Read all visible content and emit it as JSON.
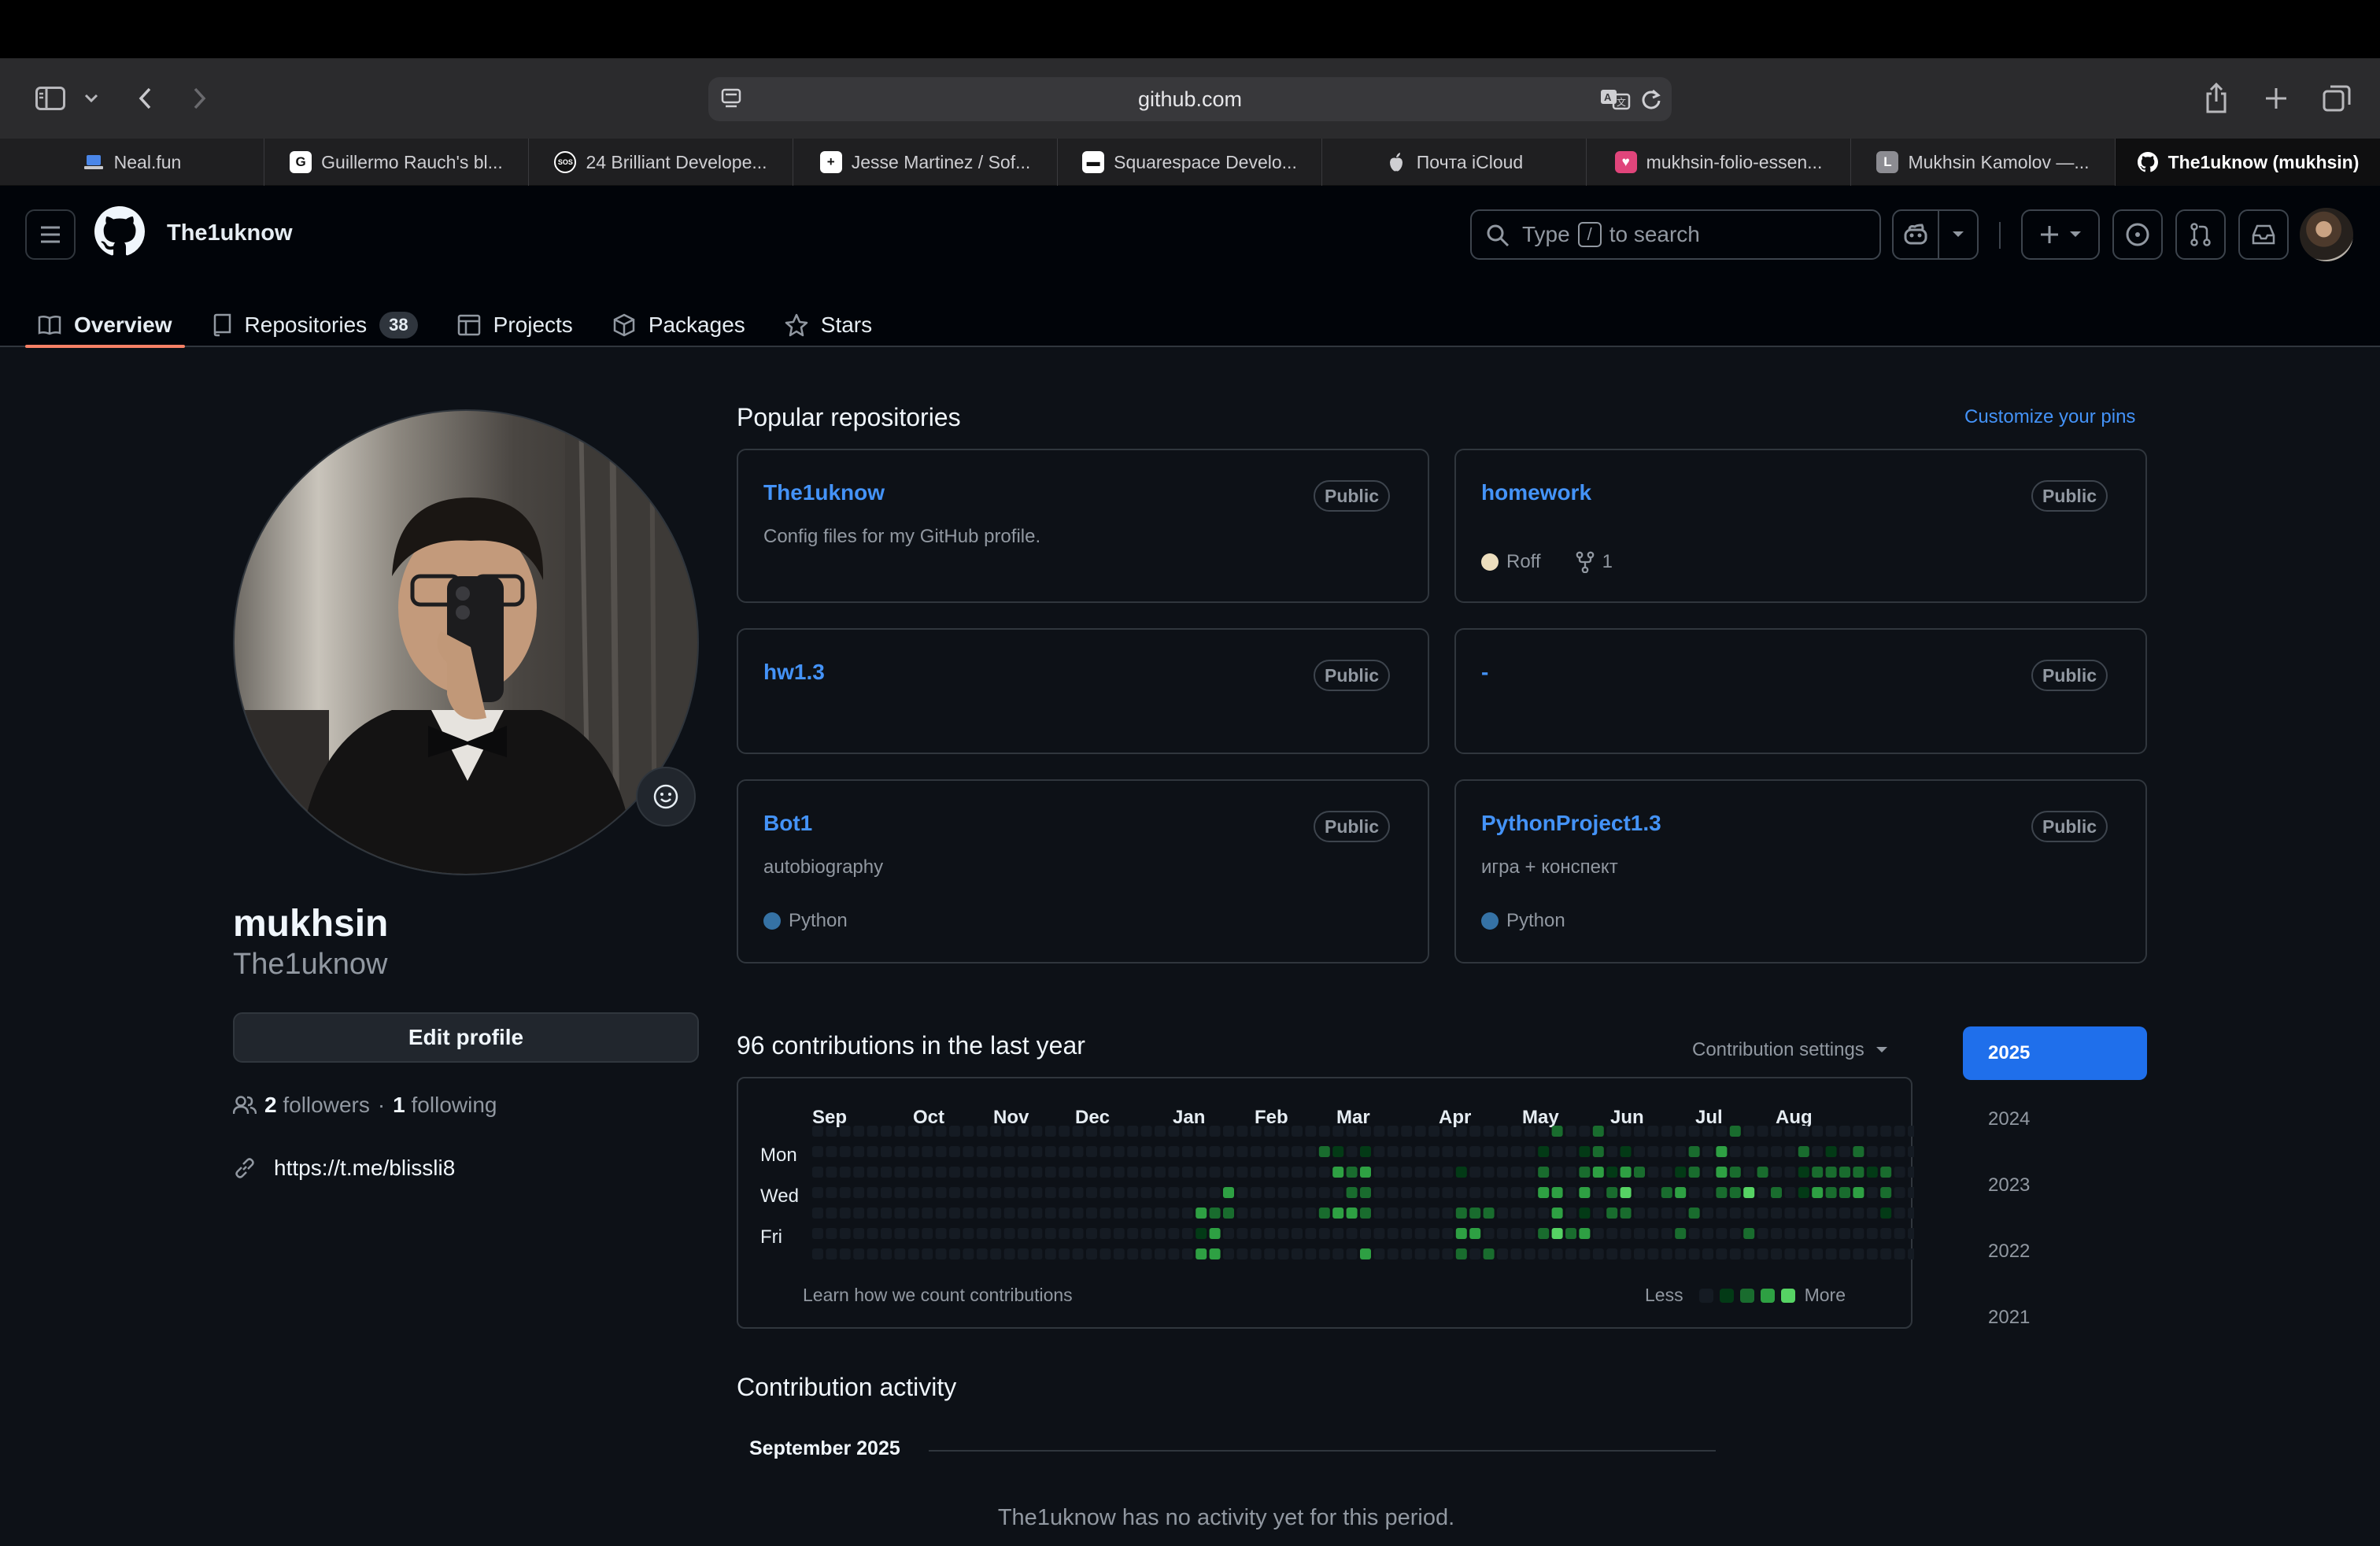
{
  "browser": {
    "url": "github.com",
    "tabs": [
      {
        "label": "Neal.fun",
        "fav": "laptop",
        "favbg": "#3b6fd8",
        "active": false
      },
      {
        "label": "Guillermo Rauch's bl...",
        "fav": "G",
        "favbg": "#ffffff",
        "active": false
      },
      {
        "label": "24 Brilliant Develope...",
        "fav": "SOS",
        "favbg": "#ffffff",
        "active": false
      },
      {
        "label": "Jesse Martinez / Sof...",
        "fav": "+",
        "favbg": "#ffffff",
        "active": false
      },
      {
        "label": "Squarespace Develo...",
        "fav": "▬",
        "favbg": "#ffffff",
        "active": false
      },
      {
        "label": "Почта iCloud",
        "fav": "",
        "favbg": "transparent",
        "active": false
      },
      {
        "label": "mukhsin-folio-essen...",
        "fav": "♥",
        "favbg": "#e0457b",
        "active": false
      },
      {
        "label": "Mukhsin Kamolov —...",
        "fav": "L",
        "favbg": "#8c8c92",
        "active": false
      },
      {
        "label": "The1uknow (mukhsin)",
        "fav": "gh",
        "favbg": "transparent",
        "active": true
      }
    ]
  },
  "header": {
    "username": "The1uknow",
    "search_prefix": "Type",
    "search_key": "/",
    "search_suffix": "to search",
    "nav": [
      {
        "label": "Overview",
        "icon": "book-icon",
        "active": true
      },
      {
        "label": "Repositories",
        "icon": "repo-icon",
        "count": "38",
        "active": false
      },
      {
        "label": "Projects",
        "icon": "table-icon",
        "active": false
      },
      {
        "label": "Packages",
        "icon": "package-icon",
        "active": false
      },
      {
        "label": "Stars",
        "icon": "star-icon",
        "active": false
      }
    ]
  },
  "profile": {
    "name": "mukhsin",
    "login": "The1uknow",
    "edit_label": "Edit profile",
    "followers_count": "2",
    "followers_label": "followers",
    "separator": "·",
    "following_count": "1",
    "following_label": "following",
    "link": "https://t.me/blissli8"
  },
  "pinned": {
    "title": "Popular repositories",
    "customize_label": "Customize your pins",
    "repos": [
      {
        "name": "The1uknow",
        "visibility": "Public",
        "description": "Config files for my GitHub profile.",
        "language": "",
        "lang_color": "",
        "forks": ""
      },
      {
        "name": "homework",
        "visibility": "Public",
        "description": "",
        "language": "Roff",
        "lang_color": "#ecdebe",
        "forks": "1"
      },
      {
        "name": "hw1.3",
        "visibility": "Public",
        "description": "",
        "language": "",
        "lang_color": "",
        "forks": ""
      },
      {
        "name": "-",
        "visibility": "Public",
        "description": "",
        "language": "",
        "lang_color": "",
        "forks": ""
      },
      {
        "name": "Bot1",
        "visibility": "Public",
        "description": "autobiography",
        "language": "Python",
        "lang_color": "#3572A5",
        "forks": ""
      },
      {
        "name": "PythonProject1.3",
        "visibility": "Public",
        "description": "игра + конспект",
        "language": "Python",
        "lang_color": "#3572A5",
        "forks": ""
      }
    ]
  },
  "contributions": {
    "title": "96 contributions in the last year",
    "settings_label": "Contribution settings",
    "months": [
      "Sep",
      "Oct",
      "Nov",
      "Dec",
      "Jan",
      "Feb",
      "Mar",
      "Apr",
      "May",
      "Jun",
      "Jul",
      "Aug"
    ],
    "days": [
      "Mon",
      "Wed",
      "Fri"
    ],
    "learn_label": "Learn how we count contributions",
    "less_label": "Less",
    "more_label": "More",
    "colors": [
      "#151b23",
      "#033a16",
      "#196c2e",
      "#2ea043",
      "#56d364"
    ],
    "weeks": 53,
    "active_cells": [
      [
        28,
        4,
        3
      ],
      [
        28,
        5,
        1
      ],
      [
        28,
        6,
        3
      ],
      [
        29,
        4,
        2
      ],
      [
        29,
        5,
        3
      ],
      [
        29,
        6,
        3
      ],
      [
        30,
        3,
        3
      ],
      [
        30,
        4,
        2
      ],
      [
        37,
        1,
        2
      ],
      [
        37,
        4,
        2
      ],
      [
        38,
        1,
        1
      ],
      [
        38,
        2,
        3
      ],
      [
        38,
        4,
        3
      ],
      [
        39,
        2,
        2
      ],
      [
        39,
        3,
        2
      ],
      [
        39,
        4,
        3
      ],
      [
        40,
        1,
        1
      ],
      [
        40,
        2,
        3
      ],
      [
        40,
        3,
        2
      ],
      [
        40,
        4,
        2
      ],
      [
        40,
        6,
        3
      ],
      [
        47,
        2,
        1
      ],
      [
        47,
        4,
        2
      ],
      [
        47,
        5,
        3
      ],
      [
        47,
        6,
        2
      ],
      [
        48,
        4,
        2
      ],
      [
        48,
        5,
        3
      ],
      [
        49,
        4,
        2
      ],
      [
        49,
        6,
        2
      ],
      [
        53,
        1,
        1
      ],
      [
        53,
        2,
        2
      ],
      [
        53,
        3,
        3
      ],
      [
        53,
        5,
        2
      ],
      [
        54,
        0,
        2
      ],
      [
        54,
        3,
        3
      ],
      [
        54,
        4,
        3
      ],
      [
        54,
        5,
        4
      ],
      [
        55,
        5,
        2
      ],
      [
        56,
        1,
        1
      ],
      [
        56,
        2,
        2
      ],
      [
        56,
        3,
        3
      ],
      [
        56,
        4,
        1
      ],
      [
        56,
        5,
        3
      ],
      [
        57,
        0,
        2
      ],
      [
        57,
        1,
        2
      ],
      [
        57,
        2,
        3
      ],
      [
        58,
        2,
        1
      ],
      [
        58,
        3,
        2
      ],
      [
        58,
        4,
        2
      ],
      [
        59,
        1,
        1
      ],
      [
        59,
        2,
        3
      ],
      [
        59,
        3,
        4
      ],
      [
        59,
        4,
        2
      ],
      [
        60,
        2,
        2
      ],
      [
        62,
        3,
        2
      ],
      [
        63,
        2,
        1
      ],
      [
        63,
        3,
        3
      ],
      [
        63,
        5,
        2
      ],
      [
        64,
        1,
        2
      ],
      [
        64,
        2,
        2
      ],
      [
        64,
        4,
        2
      ],
      [
        66,
        1,
        3
      ],
      [
        66,
        2,
        3
      ],
      [
        66,
        3,
        2
      ],
      [
        67,
        0,
        2
      ],
      [
        67,
        2,
        2
      ],
      [
        67,
        3,
        2
      ],
      [
        68,
        3,
        4
      ],
      [
        68,
        5,
        2
      ],
      [
        69,
        2,
        2
      ],
      [
        70,
        3,
        2
      ],
      [
        72,
        1,
        2
      ],
      [
        72,
        2,
        1
      ],
      [
        72,
        3,
        1
      ],
      [
        73,
        2,
        2
      ],
      [
        73,
        3,
        3
      ],
      [
        74,
        1,
        1
      ],
      [
        74,
        2,
        2
      ],
      [
        74,
        3,
        2
      ],
      [
        75,
        2,
        2
      ],
      [
        75,
        3,
        2
      ],
      [
        76,
        1,
        2
      ],
      [
        76,
        2,
        2
      ],
      [
        76,
        3,
        3
      ],
      [
        77,
        2,
        1
      ],
      [
        78,
        2,
        2
      ],
      [
        78,
        3,
        2
      ],
      [
        78,
        4,
        1
      ]
    ]
  },
  "years": [
    "2025",
    "2024",
    "2023",
    "2022",
    "2021"
  ],
  "activity": {
    "title": "Contribution activity",
    "month": "September 2025",
    "empty_message": "The1uknow has no activity yet for this period."
  }
}
